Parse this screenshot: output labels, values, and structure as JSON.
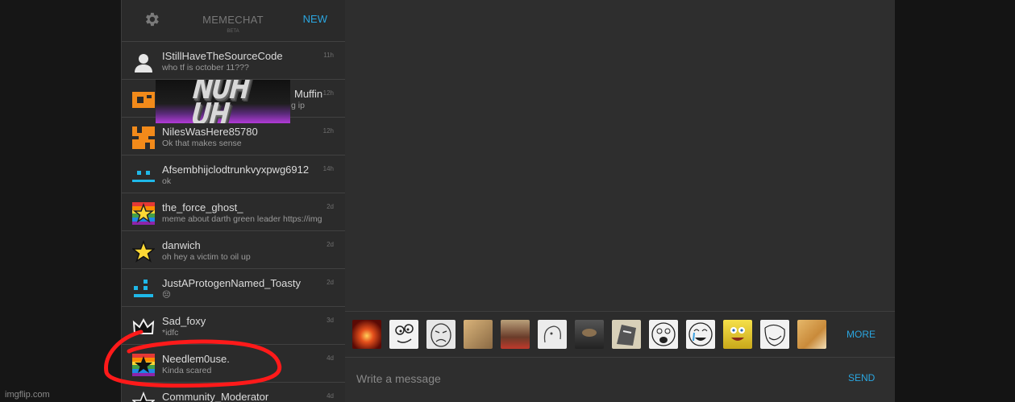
{
  "header": {
    "brand": "MEMECHAT",
    "beta": "BETA",
    "new_label": "NEW"
  },
  "conversations": [
    {
      "name": "IStillHaveTheSourceCode",
      "preview": "who tf is october 11???",
      "time": "11h",
      "avatar": "person-icon"
    },
    {
      "name": "Muffin",
      "preview": "g ip",
      "time": "12h",
      "avatar": "orange-pixel-icon"
    },
    {
      "name": "NilesWasHere85780",
      "preview": "Ok that makes sense",
      "time": "12h",
      "avatar": "orange-pixel-icon"
    },
    {
      "name": "Afsembhijclodtrunkvyxpwg6912",
      "preview": "ok",
      "time": "14h",
      "avatar": "cyan-pixel-icon"
    },
    {
      "name": "the_force_ghost_",
      "preview": "meme about darth green leader https://img",
      "time": "2d",
      "avatar": "rainbow-star-icon"
    },
    {
      "name": "danwich",
      "preview": "oh hey a victim to oil up",
      "time": "2d",
      "avatar": "yellow-star-icon"
    },
    {
      "name": "JustAProtogenNamed_Toasty",
      "preview": "😔",
      "time": "2d",
      "avatar": "cyan-pixel-icon"
    },
    {
      "name": "Sad_foxy",
      "preview": "*idfc",
      "time": "3d",
      "avatar": "crown-icon"
    },
    {
      "name": "Needlem0use.",
      "preview": "Kinda scared",
      "time": "4d",
      "avatar": "rainbow-black-star-icon"
    },
    {
      "name": "Community_Moderator",
      "preview": "",
      "time": "4d",
      "avatar": "white-star-icon"
    }
  ],
  "overlay": {
    "line1": "NUH",
    "line2": "UH"
  },
  "stickers": [
    "explosion-sticker",
    "derp-sticker",
    "sad-face-sticker",
    "cat-sticker",
    "jesus-sticker",
    "meme-face-sticker",
    "doge-dark-sticker",
    "cat-drawing-sticker",
    "omg-face-sticker",
    "tears-face-sticker",
    "spongebob-sticker",
    "troll-face-sticker",
    "doge-sticker"
  ],
  "more_label": "MORE",
  "composer": {
    "placeholder": "Write a message",
    "send_label": "SEND"
  },
  "watermark": "imgflip.com",
  "colors": {
    "accent": "#2aa6e0",
    "annotation": "#ff1a1a"
  }
}
